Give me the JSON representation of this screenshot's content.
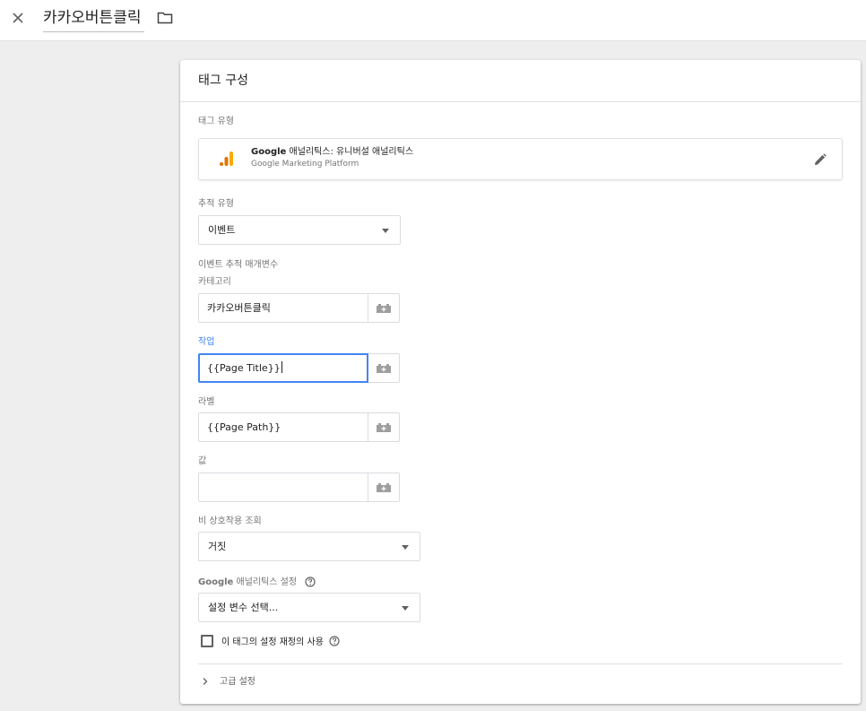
{
  "header": {
    "title": "카카오버튼클릭",
    "close_icon": "close-icon",
    "folder_icon": "folder-icon"
  },
  "card": {
    "title": "태그 구성",
    "tag_type_label": "태그 유형",
    "tag_type": {
      "name_bold": "Google",
      "name_rest": " 애널리틱스: 유니버설 애널리틱스",
      "subtitle": "Google Marketing Platform",
      "icon": "google-analytics-icon",
      "edit_icon": "pencil-icon"
    },
    "track_type": {
      "label": "추적 유형",
      "value": "이벤트"
    },
    "event_params_label": "이벤트 추적 매개변수",
    "category": {
      "label": "카테고리",
      "value": "카카오버튼클릭"
    },
    "action": {
      "label": "작업",
      "value": "{{Page Title}}"
    },
    "label_field": {
      "label": "라벨",
      "value": "{{Page Path}}"
    },
    "value_field": {
      "label": "값",
      "value": ""
    },
    "non_interaction": {
      "label": "비 상호작용 조회",
      "value": "거짓"
    },
    "ga_settings": {
      "label_bold": "Google",
      "label_rest": " 애널리틱스 설정",
      "value": "설정 변수 선택..."
    },
    "override": {
      "label": "이 태그의 설정 재정의 사용",
      "checked": false
    },
    "advanced": {
      "label": "고급 설정"
    }
  },
  "colors": {
    "accent": "#4285f4",
    "ga_orange": "#f9ab00",
    "ga_dark_orange": "#e37400",
    "background": "#eeeeee"
  }
}
